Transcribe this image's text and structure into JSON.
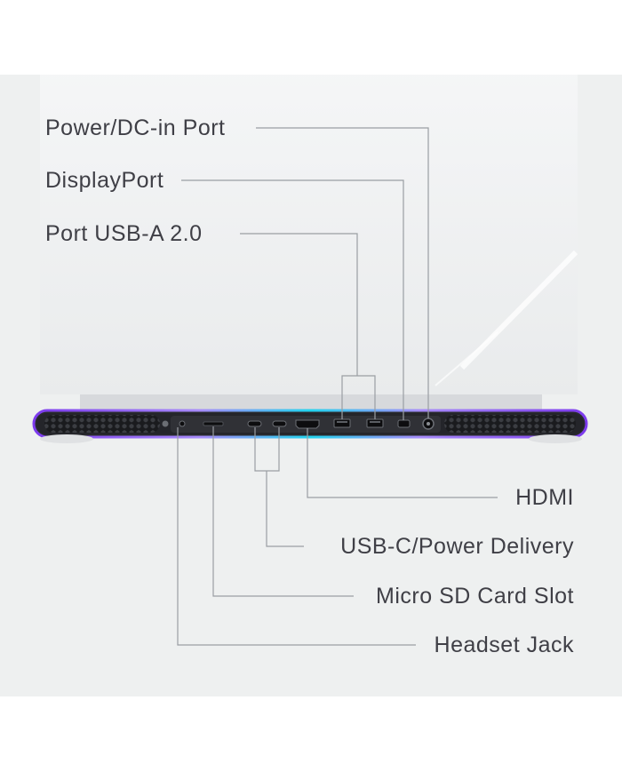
{
  "top_labels": {
    "power": "Power/DC-in Port",
    "displayport": "DisplayPort",
    "usba": "Port USB-A 2.0"
  },
  "bottom_labels": {
    "hdmi": "HDMI",
    "usbc": "USB-C/Power Delivery",
    "microsd": "Micro SD Card Slot",
    "headset": "Headset Jack"
  },
  "colors": {
    "background": "#eef0f0",
    "lid": "#f4f5f6",
    "accent_glow": "#8b5cf6",
    "text": "#3f3f46"
  }
}
